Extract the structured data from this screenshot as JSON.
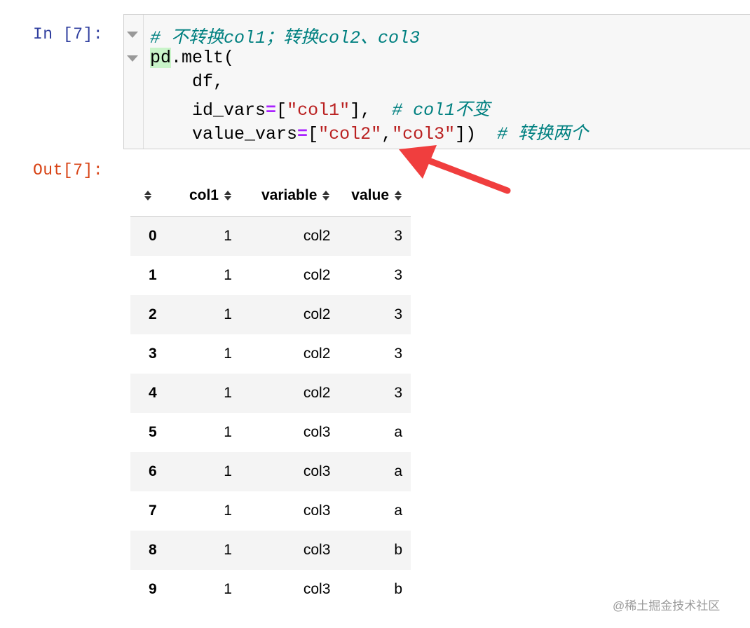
{
  "notebook": {
    "in_prompt": "In [7]:",
    "out_prompt": "Out[7]:",
    "code": {
      "line1_comment": "# 不转换col1；转换col2、col3",
      "line2_obj": "pd",
      "line2_rest": ".melt(",
      "line3": "    df,",
      "line4_pre": "    id_vars",
      "line4_eq": "=",
      "line4_open": "[",
      "line4_str": "\"col1\"",
      "line4_close": "],  ",
      "line4_comment": "# col1不变",
      "line5_pre": "    value_vars",
      "line5_eq": "=",
      "line5_open": "[",
      "line5_str1": "\"col2\"",
      "line5_comma": ",",
      "line5_str2": "\"col3\"",
      "line5_close": "])  ",
      "line5_comment": "# 转换两个"
    }
  },
  "table": {
    "headers": [
      "",
      "col1",
      "variable",
      "value"
    ],
    "rows": [
      {
        "index": "0",
        "col1": "1",
        "variable": "col2",
        "value": "3"
      },
      {
        "index": "1",
        "col1": "1",
        "variable": "col2",
        "value": "3"
      },
      {
        "index": "2",
        "col1": "1",
        "variable": "col2",
        "value": "3"
      },
      {
        "index": "3",
        "col1": "1",
        "variable": "col2",
        "value": "3"
      },
      {
        "index": "4",
        "col1": "1",
        "variable": "col2",
        "value": "3"
      },
      {
        "index": "5",
        "col1": "1",
        "variable": "col3",
        "value": "a"
      },
      {
        "index": "6",
        "col1": "1",
        "variable": "col3",
        "value": "a"
      },
      {
        "index": "7",
        "col1": "1",
        "variable": "col3",
        "value": "a"
      },
      {
        "index": "8",
        "col1": "1",
        "variable": "col3",
        "value": "b"
      },
      {
        "index": "9",
        "col1": "1",
        "variable": "col3",
        "value": "b"
      }
    ]
  },
  "annotation": {
    "arrow_color": "#f03e3e"
  },
  "watermark": "@稀土掘金技术社区",
  "colors": {
    "in_prompt": "#303f9f",
    "out_prompt": "#d84315",
    "comment": "#008080",
    "string": "#ba2121",
    "operator": "#aa22ff"
  }
}
